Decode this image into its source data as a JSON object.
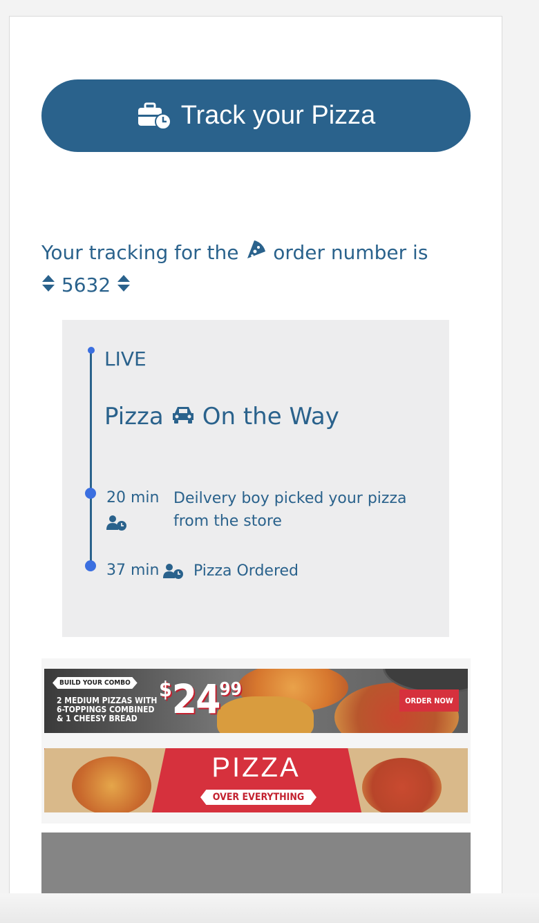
{
  "track_button": {
    "label": "Track your Pizza",
    "icon": "briefcase-clock-icon"
  },
  "order": {
    "prefix": "Your tracking for the",
    "icon": "pizza-slice-icon",
    "suffix": "order number is",
    "number": "5632",
    "number_icon": "sort-icon"
  },
  "timeline": {
    "live_label": "LIVE",
    "status_before": "Pizza",
    "status_icon": "car-icon",
    "status_after": "On the Way",
    "events": [
      {
        "time": "20 min",
        "icon": "user-clock-icon",
        "description_line1": "Deilvery boy picked your pizza",
        "description_line2": "from the store"
      },
      {
        "time": "37 min",
        "icon": "user-clock-icon",
        "description": "Pizza Ordered"
      }
    ]
  },
  "banner1": {
    "tag": "BUILD YOUR COMBO",
    "line1": "2 MEDIUM PIZZAS WITH",
    "line2": "6-TOPPINGS COMBINED",
    "line3": "& 1 CHEESY BREAD",
    "price_dollar": "$",
    "price_main": "24",
    "price_cents": "99",
    "cta": "ORDER NOW"
  },
  "banner2": {
    "title": "PIZZA",
    "subtitle": "OVER EVERYTHING"
  },
  "colors": {
    "primary": "#2a628c",
    "dot": "#3b6fe0",
    "promo_red": "#d6313d"
  }
}
